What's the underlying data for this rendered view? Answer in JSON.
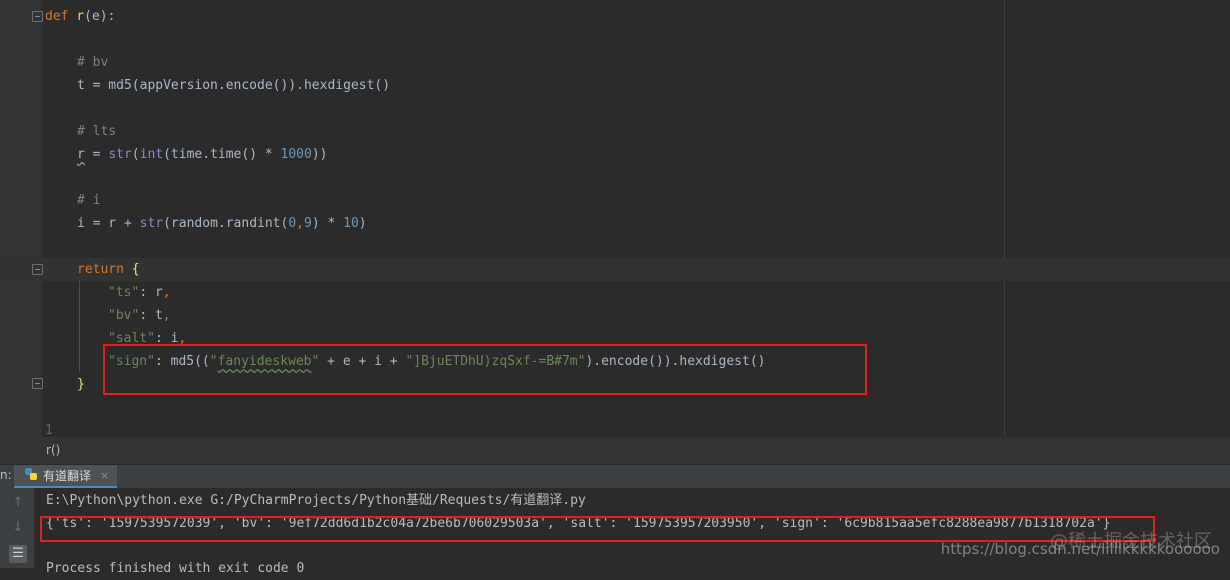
{
  "editor": {
    "line_def": {
      "kw": "def ",
      "fn": "r",
      "rest": "(e):"
    },
    "c_bv": "# bv",
    "line_t": {
      "a": "t = md5(appVersion.encode()).hexdigest()"
    },
    "c_lts": "# lts",
    "line_r": {
      "v": "r",
      "a": " = ",
      "b1": "str",
      "p1": "(",
      "b2": "int",
      "p2": "(time.time() * ",
      "n": "1000",
      "p3": "))"
    },
    "c_i": "# i",
    "line_i": {
      "a": "i = r + ",
      "b": "str",
      "c": "(random.randint(",
      "n1": "0",
      "c2": ",",
      "n2": "9",
      "c3": ") * ",
      "n3": "10",
      "c4": ")"
    },
    "line_return": {
      "kw": "return ",
      "brace": "{"
    },
    "line_ts": {
      "k": "\"ts\"",
      "a": ": r",
      "comma": ","
    },
    "line_bv": {
      "k": "\"bv\"",
      "a": ": t",
      "comma": ","
    },
    "line_salt": {
      "k": "\"salt\"",
      "a": ": i",
      "comma": ","
    },
    "line_sign": {
      "k": "\"sign\"",
      "a": ": md5((",
      "s1q1": "\"",
      "s1": "fanyideskweb",
      "s1q2": "\"",
      "b": " + e + i + ",
      "s2": "\"]BjuETDhU)zqSxf-=B#7m\"",
      "c": ").encode()).hexdigest()"
    },
    "line_close": "}",
    "line_num": "1"
  },
  "breadcrumb": "r()",
  "run_panel": {
    "label": "n:",
    "tab_label": "有道翻译",
    "close": "×"
  },
  "console": {
    "cmd": "E:\\Python\\python.exe G:/PyCharmProjects/Python基础/Requests/有道翻译.py",
    "output": "{'ts': '1597539572039', 'bv': '9ef72dd6d1b2c04a72be6b706029503a', 'salt': '159753957203950', 'sign': '6c9b815aa5efc8288ea9877b1318702a'}",
    "finished": "Process finished with exit code 0"
  },
  "watermark": {
    "line1": "@稀土掘金技术社区",
    "line2": "https://blog.csdn.net/lilllkkkkkoooooo"
  },
  "colors": {
    "background": "#2b2b2b",
    "keyword": "#cc7832",
    "string": "#6a8759",
    "number": "#6897bb",
    "comment": "#808080",
    "highlight_box": "#e02020"
  },
  "icons": [
    "fold-icon",
    "python-file-icon",
    "up-arrow-icon",
    "down-arrow-icon",
    "wrap-icon"
  ]
}
